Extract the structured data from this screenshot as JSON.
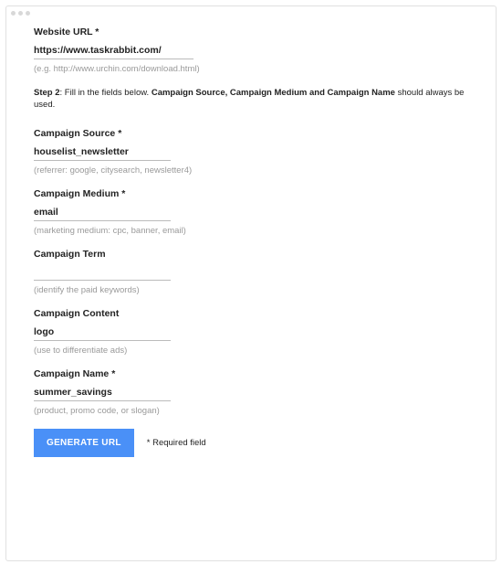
{
  "fields": {
    "website_url": {
      "label": "Website URL *",
      "value": "https://www.taskrabbit.com/",
      "hint": "(e.g. http://www.urchin.com/download.html)"
    },
    "campaign_source": {
      "label": "Campaign Source *",
      "value": "houselist_newsletter",
      "hint": "(referrer: google, citysearch, newsletter4)"
    },
    "campaign_medium": {
      "label": "Campaign Medium *",
      "value": "email",
      "hint": "(marketing medium: cpc, banner, email)"
    },
    "campaign_term": {
      "label": "Campaign Term",
      "value": "",
      "hint": "(identify the paid keywords)"
    },
    "campaign_content": {
      "label": "Campaign Content",
      "value": "logo",
      "hint": "(use to differentiate ads)"
    },
    "campaign_name": {
      "label": "Campaign Name *",
      "value": "summer_savings",
      "hint": "(product, promo code, or slogan)"
    }
  },
  "step2": {
    "prefix_bold": "Step 2",
    "middle": ": Fill in the fields below. ",
    "bold_part": "Campaign Source, Campaign Medium and Campaign Name",
    "suffix": " should always be used."
  },
  "button": {
    "label": "GENERATE URL"
  },
  "required_note": "* Required field"
}
